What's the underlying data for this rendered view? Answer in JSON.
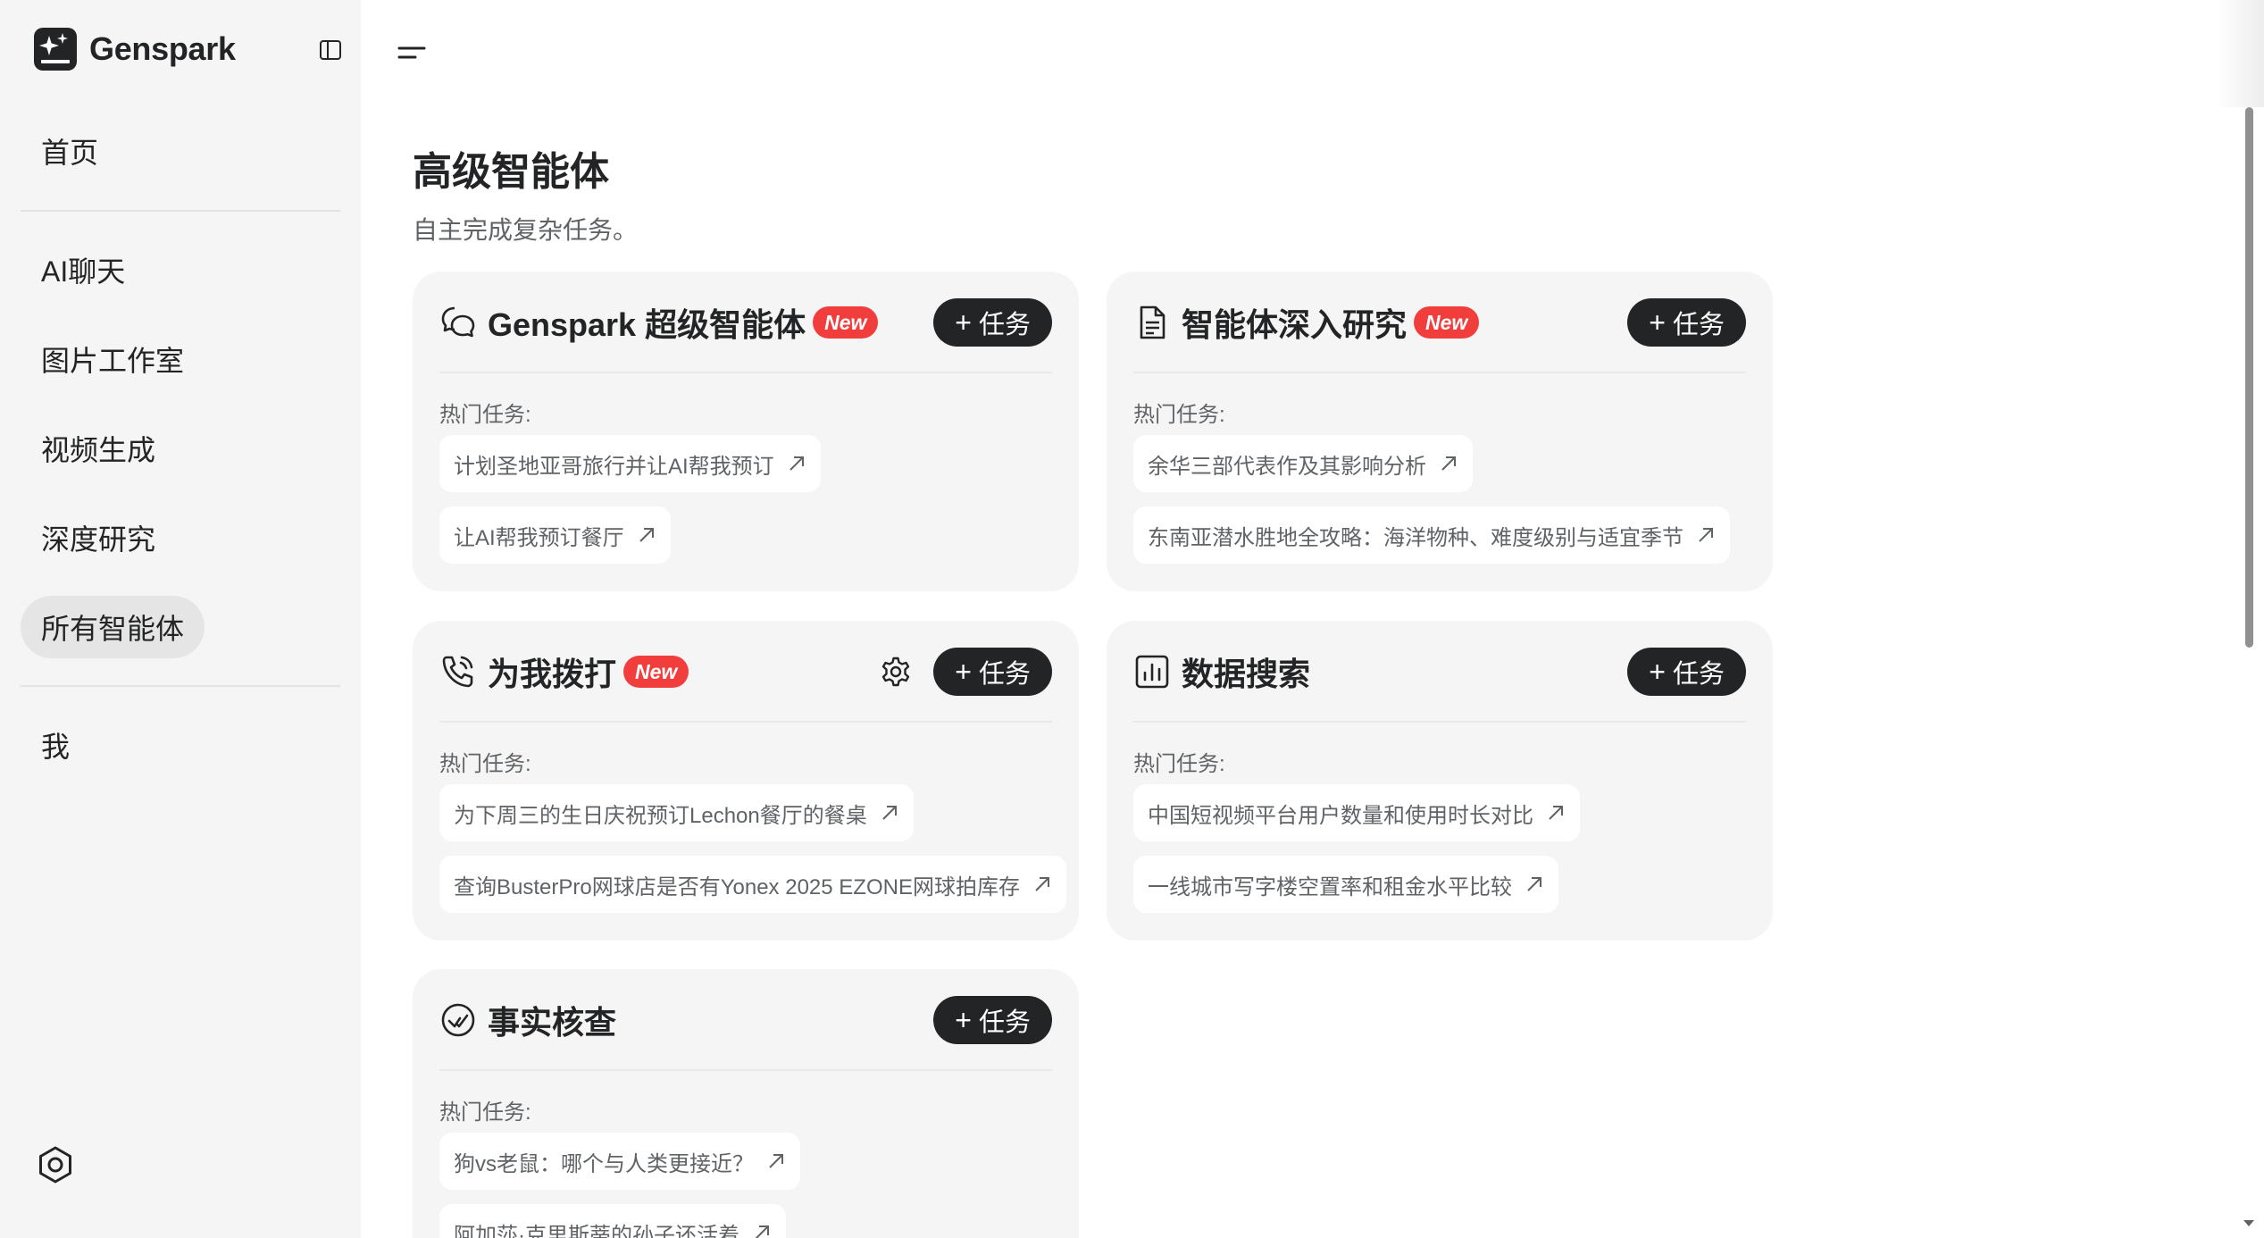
{
  "brand": {
    "name": "Genspark"
  },
  "sidebar": {
    "items": [
      {
        "label": "首页"
      },
      {
        "label": "AI聊天"
      },
      {
        "label": "图片工作室"
      },
      {
        "label": "视频生成"
      },
      {
        "label": "深度研究"
      },
      {
        "label": "所有智能体",
        "active": true
      },
      {
        "label": "我"
      }
    ]
  },
  "main": {
    "title": "高级智能体",
    "subtitle": "自主完成复杂任务。"
  },
  "cards": [
    {
      "icon": "chat-bubbles-icon",
      "title": "Genspark 超级智能体",
      "badge": "New",
      "button": "任务",
      "hot_label": "热门任务:",
      "tasks": [
        "计划圣地亚哥旅行并让AI帮我预订",
        "让AI帮我预订餐厅"
      ]
    },
    {
      "icon": "document-icon",
      "title": "智能体深入研究",
      "badge": "New",
      "button": "任务",
      "hot_label": "热门任务:",
      "tasks": [
        "余华三部代表作及其影响分析",
        "东南亚潜水胜地全攻略：海洋物种、难度级别与适宜季节"
      ]
    },
    {
      "icon": "phone-call-icon",
      "title": "为我拨打",
      "badge": "New",
      "button": "任务",
      "hot_label": "热门任务:",
      "tasks": [
        "为下周三的生日庆祝预订Lechon餐厅的餐桌",
        "查询BusterPro网球店是否有Yonex 2025 EZONE网球拍库存"
      ]
    },
    {
      "icon": "bar-chart-icon",
      "title": "数据搜索",
      "button": "任务",
      "hot_label": "热门任务:",
      "tasks": [
        "中国短视频平台用户数量和使用时长对比",
        "一线城市写字楼空置率和租金水平比较"
      ]
    },
    {
      "icon": "check-circle-icon",
      "title": "事实核查",
      "button": "任务",
      "hot_label": "热门任务:",
      "tasks": [
        "狗vs老鼠：哪个与人类更接近？",
        "阿加莎·克里斯蒂的孙子还活着"
      ]
    }
  ],
  "colors": {
    "accent": "#232425",
    "badge": "#f23d3d",
    "card_bg": "#f5f5f5",
    "sidebar_bg": "#f5f5f5"
  }
}
